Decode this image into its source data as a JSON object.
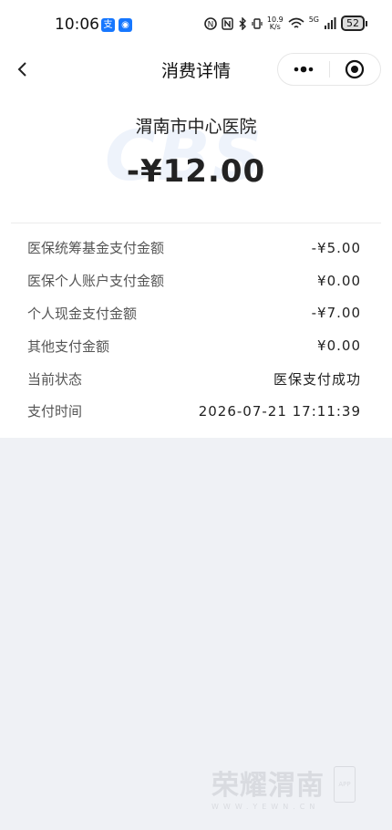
{
  "status_bar": {
    "time": "10:06",
    "net_speed_value": "10.9",
    "net_speed_unit": "K/s",
    "network": "5G",
    "battery": "52",
    "app_badges": [
      {
        "name": "alipay-badge",
        "glyph": "支",
        "color": "#1677ff"
      },
      {
        "name": "location-badge",
        "glyph": "◉",
        "color": "#1677ff"
      }
    ]
  },
  "nav": {
    "title": "消费详情",
    "more_icon": "more-dots-icon",
    "close_icon": "target-circle-icon"
  },
  "summary": {
    "hospital": "渭南市中心医院",
    "amount": "-¥12.00",
    "watermark": "CBS"
  },
  "details": [
    {
      "label": "医保统筹基金支付金额",
      "value": "-¥5.00"
    },
    {
      "label": "医保个人账户支付金额",
      "value": "¥0.00"
    },
    {
      "label": "个人现金支付金额",
      "value": "-¥7.00"
    },
    {
      "label": "其他支付金额",
      "value": "¥0.00"
    },
    {
      "label": "当前状态",
      "value": "医保支付成功"
    },
    {
      "label": "支付时间",
      "value": "2026-07-21 17:11:39"
    }
  ],
  "footer_watermark": {
    "brand": "荣耀渭南",
    "url": "WWW.YEWN.CN",
    "badge": "APP"
  },
  "colors": {
    "page_bg": "#eff1f5",
    "card_bg": "#ffffff",
    "accent": "#1677ff"
  }
}
